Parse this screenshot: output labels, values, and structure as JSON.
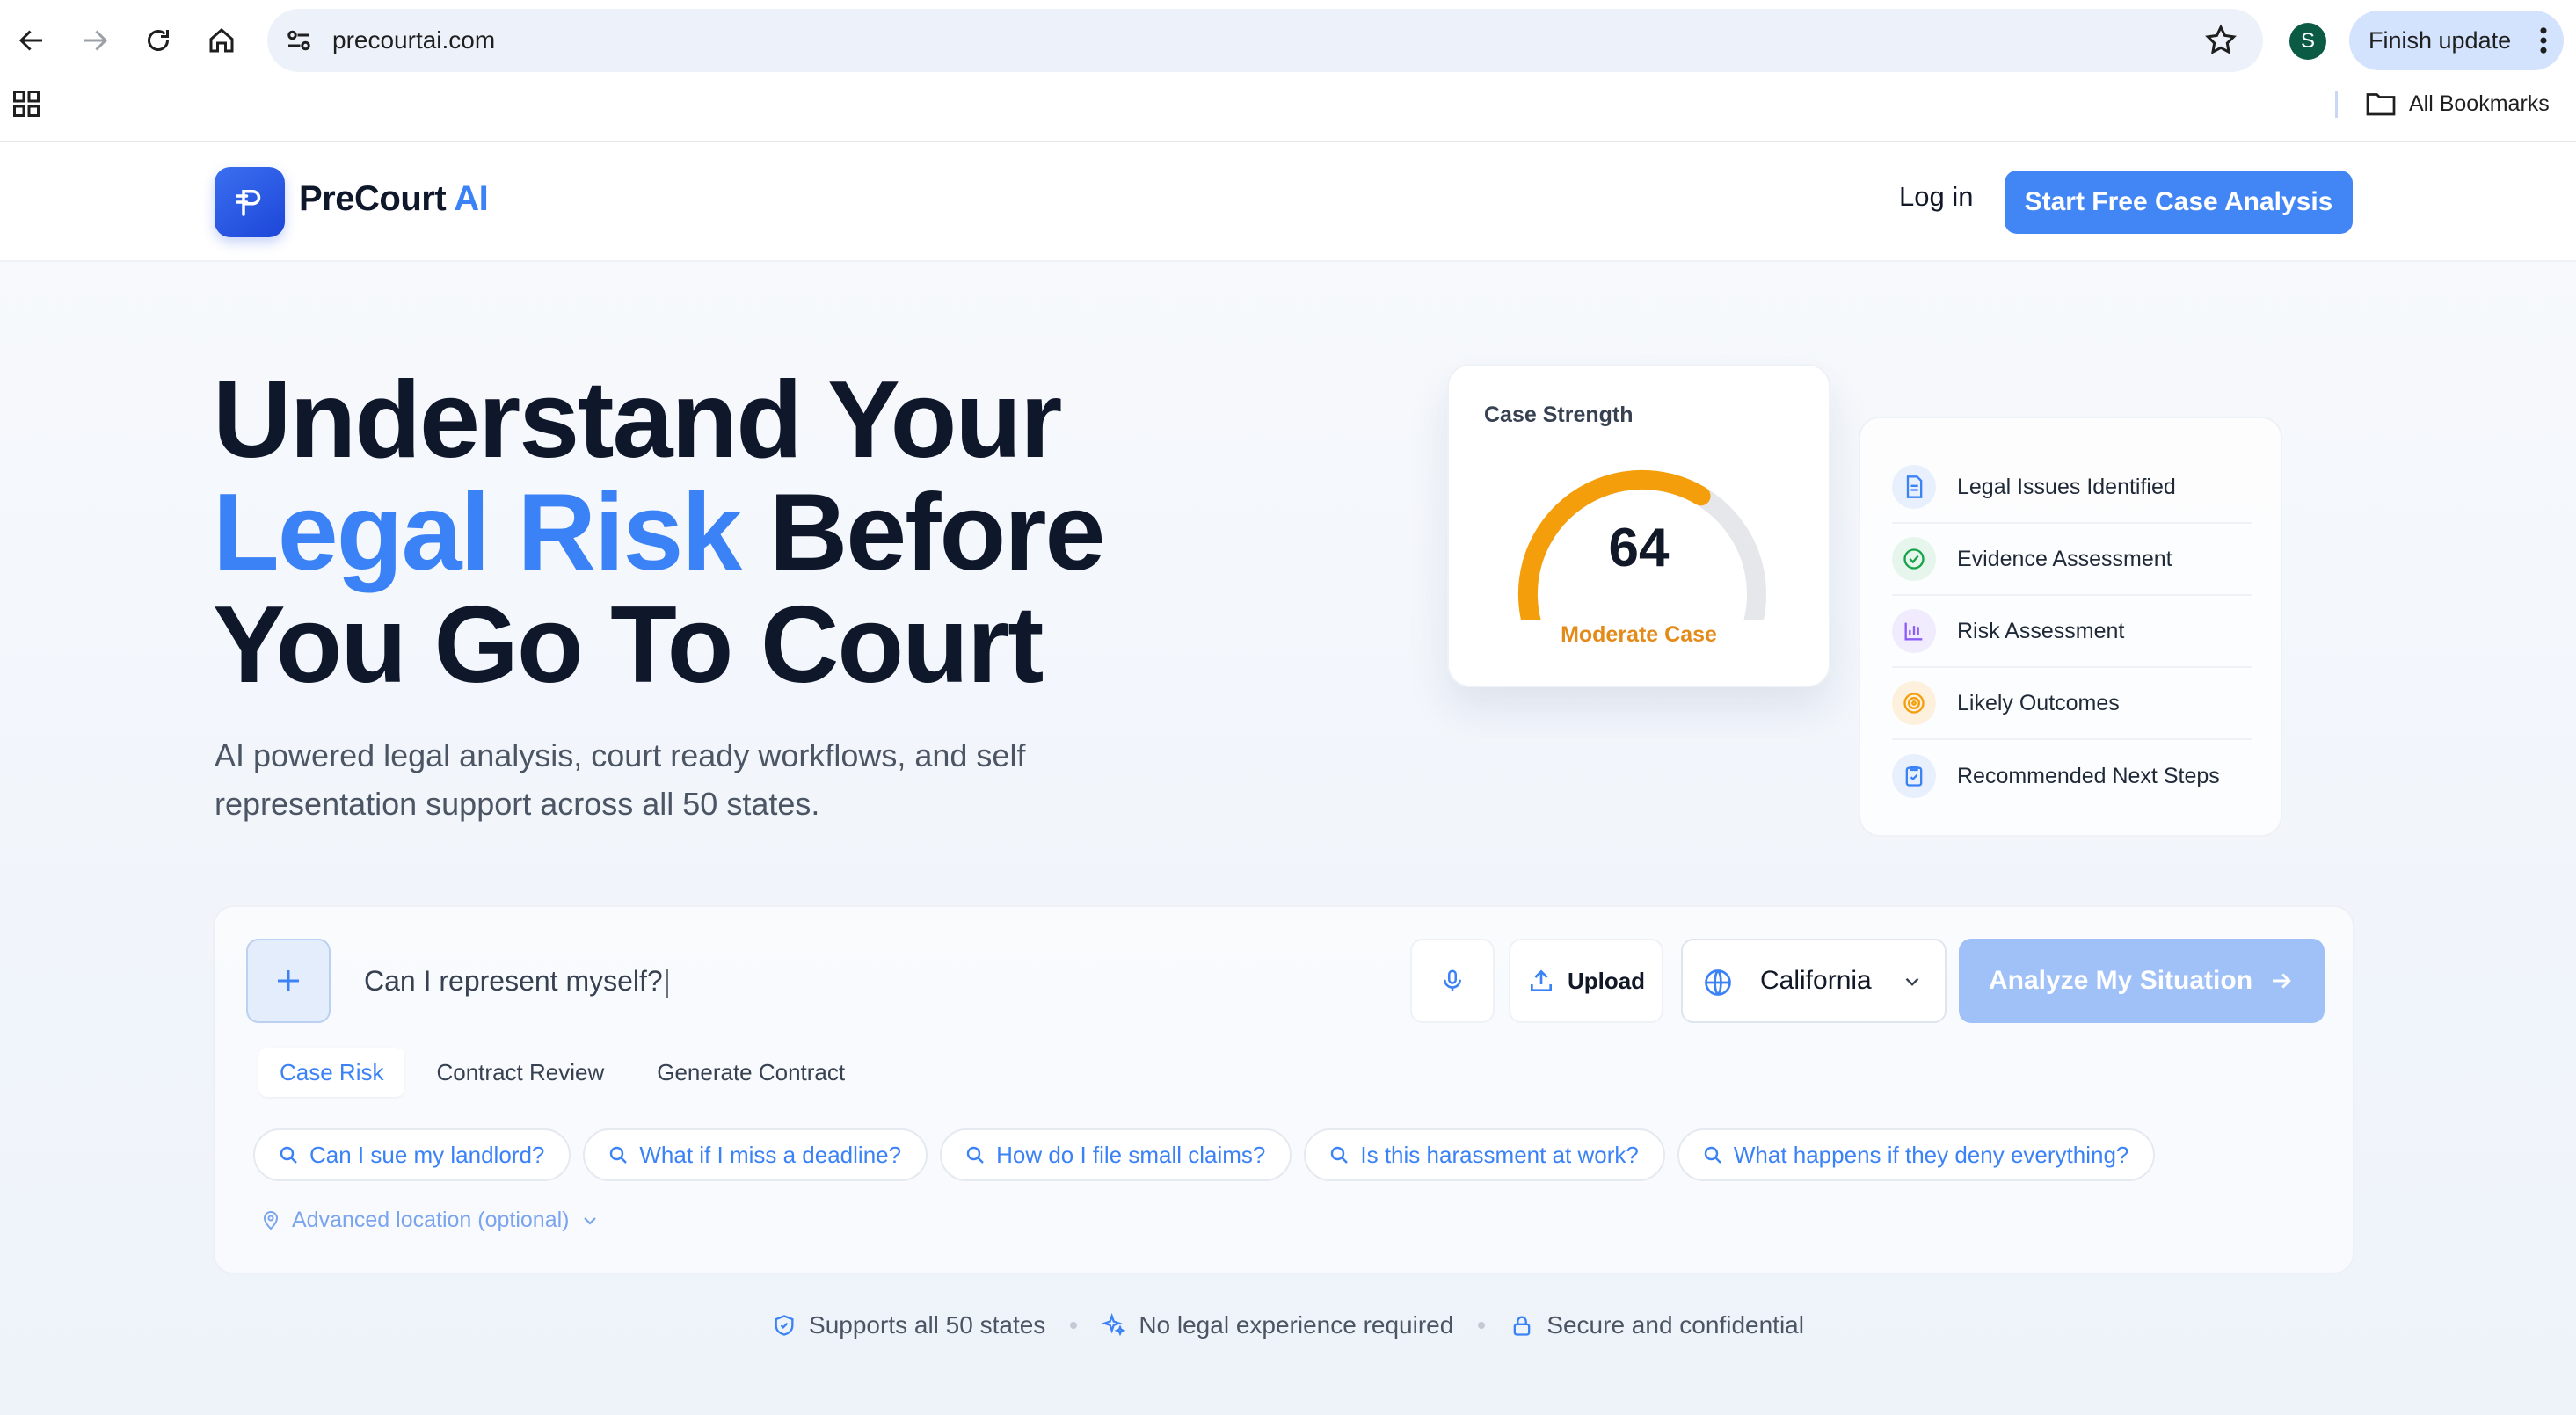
{
  "browser": {
    "url": "precourtai.com",
    "profile_initial": "S",
    "finish_update_label": "Finish update",
    "bookmarks_label": "All Bookmarks"
  },
  "header": {
    "brand_main": "PreCourt",
    "brand_accent": "AI",
    "login_label": "Log in",
    "cta_label": "Start Free Case Analysis"
  },
  "hero": {
    "title_line1": "Understand Your",
    "title_accent": "Legal Risk",
    "title_line2_rest": " Before",
    "title_line3": "You Go To Court",
    "subtitle": "AI powered legal analysis, court ready workflows, and self representation support across all 50 states."
  },
  "gauge": {
    "label": "Case Strength",
    "value": "64",
    "score_fraction": 0.64,
    "status": "Moderate Case",
    "color_fill": "#f59e0b",
    "color_track": "#e5e7eb"
  },
  "features": [
    {
      "label": "Legal Issues Identified",
      "icon": "document-icon",
      "color": "#3b82f6",
      "bg": "#e8f0fe"
    },
    {
      "label": "Evidence Assessment",
      "icon": "check-circle-icon",
      "color": "#16a34a",
      "bg": "#e7f6ec"
    },
    {
      "label": "Risk Assessment",
      "icon": "bar-chart-icon",
      "color": "#8b5cf6",
      "bg": "#f1ecfd"
    },
    {
      "label": "Likely Outcomes",
      "icon": "target-icon",
      "color": "#f59e0b",
      "bg": "#fdf1de"
    },
    {
      "label": "Recommended Next Steps",
      "icon": "clipboard-icon",
      "color": "#3b82f6",
      "bg": "#e8f0fe"
    }
  ],
  "search": {
    "query": "Can I represent myself?",
    "upload_label": "Upload",
    "state_value": "California",
    "analyze_label": "Analyze My Situation"
  },
  "modes": [
    "Case Risk",
    "Contract Review",
    "Generate Contract"
  ],
  "active_mode": "Case Risk",
  "suggestions": [
    "Can I sue my landlord?",
    "What if I miss a deadline?",
    "How do I file small claims?",
    "Is this harassment at work?",
    "What happens if they deny everything?"
  ],
  "advanced_location_label": "Advanced location (optional)",
  "trust": [
    "Supports all 50 states",
    "No legal experience required",
    "Secure and confidential"
  ],
  "colors": {
    "accent": "#3b82f6",
    "cta": "#4285f4",
    "cta_disabled": "#9fc1f8",
    "heading": "#0f172a"
  }
}
